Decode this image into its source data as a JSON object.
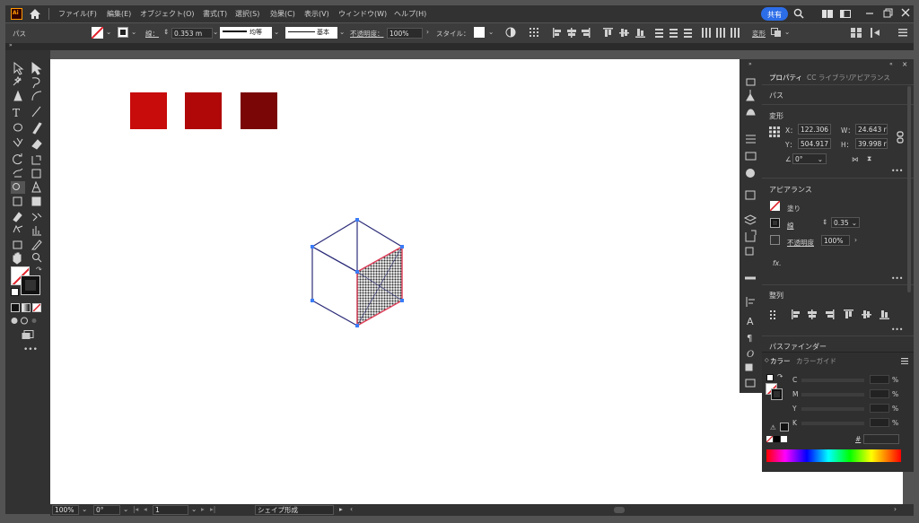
{
  "app": {
    "logo": "Ai"
  },
  "menu": [
    "ファイル(F)",
    "編集(E)",
    "オブジェクト(O)",
    "書式(T)",
    "選択(S)",
    "効果(C)",
    "表示(V)",
    "ウィンドウ(W)",
    "ヘルプ(H)"
  ],
  "header": {
    "share_label": "共有"
  },
  "control": {
    "selection_label": "パス",
    "stroke_label": "線：",
    "stroke_value": "0.353 m",
    "profile_label": "均等",
    "brush_label": "基本",
    "opacity_label": "不透明度：",
    "opacity_value": "100%",
    "style_label": "スタイル：",
    "transform_label": "変形"
  },
  "panel": {
    "tabs": [
      "プロパティ",
      "CC ライブラリ",
      "アピアランス"
    ],
    "selection_type": "パス",
    "transform": {
      "title": "変形",
      "x_label": "X：",
      "x_value": "122.306",
      "y_label": "Y：",
      "y_value": "504.917",
      "w_label": "W：",
      "w_value": "24.643 r",
      "h_label": "H：",
      "h_value": "39.998 r",
      "angle_value": "0°"
    },
    "appearance": {
      "title": "アピアランス",
      "fill_label": "塗り",
      "stroke_label": "線",
      "stroke_value": "0.35",
      "opacity_label": "不透明度",
      "opacity_value": "100%",
      "fx_label": "fx."
    },
    "align": {
      "title": "整列"
    },
    "pathfinder": {
      "title": "パスファインダー"
    }
  },
  "color_panel": {
    "tabs": [
      "カラー",
      "カラーガイド"
    ],
    "channels": [
      {
        "label": "C",
        "unit": "%"
      },
      {
        "label": "M",
        "unit": "%"
      },
      {
        "label": "Y",
        "unit": "%"
      },
      {
        "label": "K",
        "unit": "%"
      }
    ]
  },
  "status": {
    "zoom": "100%",
    "rotation": "0°",
    "artboard": "1",
    "tool_name": "シェイプ形成"
  },
  "swatches": [
    "#c80b0b",
    "#b00808",
    "#7a0606"
  ],
  "colors": {
    "accent_blue": "#3a7cf7",
    "share_button": "#2c6de8",
    "cube_stroke": "#2d2d7a",
    "cube_highlight": "#e0405a",
    "workspace": "#535353",
    "panel_bg": "#323232"
  },
  "icons": [
    "home-icon",
    "search-icon",
    "arrange-icon",
    "minimize-icon",
    "restore-icon",
    "close-icon",
    "selection-tool-icon",
    "direct-selection-tool-icon",
    "magic-wand-icon",
    "lasso-icon",
    "pen-icon",
    "curvature-icon",
    "type-icon",
    "line-icon",
    "ellipse-icon",
    "paintbrush-icon",
    "shaper-icon",
    "eraser-icon",
    "rotate-icon",
    "scale-icon",
    "warp-icon",
    "free-transform-icon",
    "shape-builder-icon",
    "perspective-icon",
    "mesh-icon",
    "gradient-icon",
    "eyedropper-icon",
    "blend-icon",
    "symbol-sprayer-icon",
    "column-graph-icon",
    "artboard-icon",
    "slice-icon",
    "hand-icon",
    "zoom-icon",
    "swap-colors-icon",
    "default-colors-icon",
    "draw-mode-icon",
    "screen-mode-icon",
    "more-icon",
    "link-icon",
    "align-icon",
    "fx-icon"
  ]
}
